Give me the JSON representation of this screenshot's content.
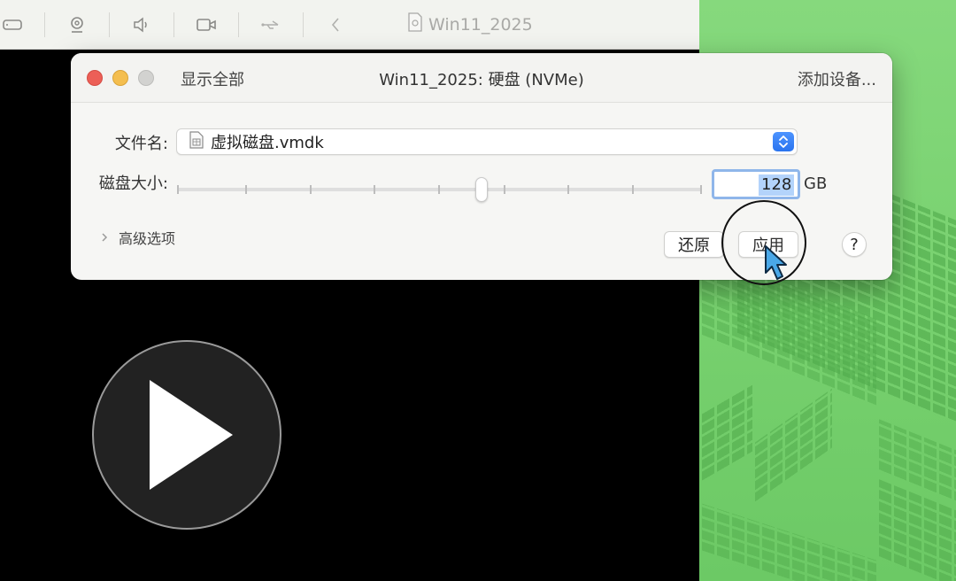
{
  "vm_window": {
    "title": "Win11_2025",
    "toolbar_icons": [
      "drive-icon",
      "webcam-icon",
      "speaker-icon",
      "camera-icon",
      "usb-icon",
      "back-chevron-icon"
    ]
  },
  "dialog": {
    "show_all_label": "显示全部",
    "title": "Win11_2025: 硬盘 (NVMe)",
    "add_device_label": "添加设备...",
    "file_name_label": "文件名:",
    "file_name_value": "虚拟磁盘.vmdk",
    "disk_size_label": "磁盘大小:",
    "disk_size_value": "128",
    "disk_size_unit": "GB",
    "slider_position_fraction": 0.58,
    "advanced_label": "高级选项",
    "revert_label": "还原",
    "apply_label": "应用",
    "help_label": "?"
  },
  "colors": {
    "accent": "#2a74ef",
    "close": "#ec5f57",
    "minimize": "#f4be4f",
    "wallpaper": "#78d16f",
    "cursor": "#4aa8e8"
  }
}
